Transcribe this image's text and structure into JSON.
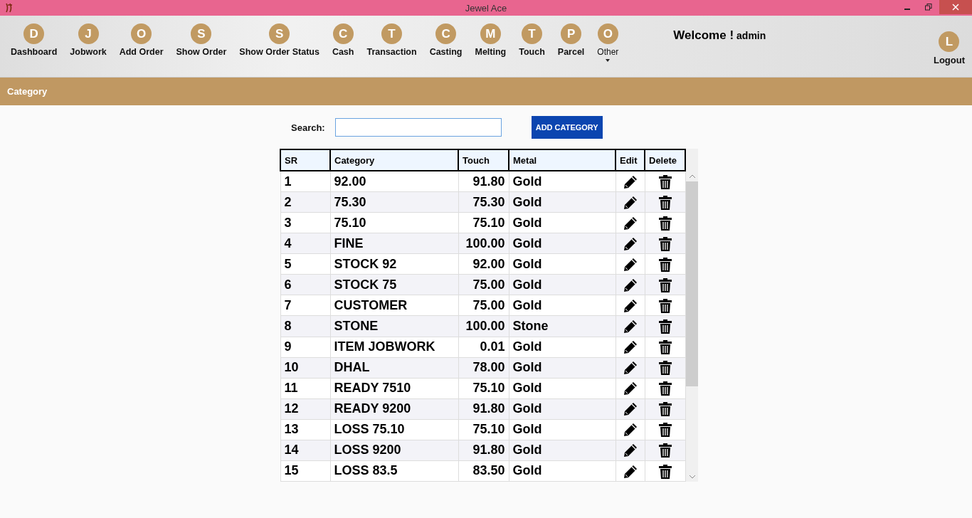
{
  "window": {
    "title": "Jewel Ace"
  },
  "nav": {
    "items": [
      {
        "letter": "D",
        "label": "Dashboard",
        "kind": "link"
      },
      {
        "letter": "J",
        "label": "Jobwork",
        "kind": "link"
      },
      {
        "letter": "O",
        "label": "Add Order",
        "kind": "link"
      },
      {
        "letter": "S",
        "label": "Show Order",
        "kind": "link"
      },
      {
        "letter": "S",
        "label": "Show Order Status",
        "kind": "link"
      },
      {
        "letter": "C",
        "label": "Cash",
        "kind": "link"
      },
      {
        "letter": "T",
        "label": "Transaction",
        "kind": "link"
      },
      {
        "letter": "C",
        "label": "Casting",
        "kind": "link"
      },
      {
        "letter": "M",
        "label": "Melting",
        "kind": "link"
      },
      {
        "letter": "T",
        "label": "Touch",
        "kind": "link"
      },
      {
        "letter": "P",
        "label": "Parcel",
        "kind": "link"
      },
      {
        "letter": "O",
        "label": "Other",
        "kind": "dropdown"
      }
    ],
    "welcome": "Welcome !",
    "user": "admin",
    "logout": {
      "letter": "L",
      "label": "Logout"
    }
  },
  "section_title": "Category",
  "search": {
    "label": "Search:"
  },
  "add_button": "ADD CATEGORY",
  "table": {
    "columns": [
      "SR",
      "Category",
      "Touch",
      "Metal",
      "Edit",
      "Delete"
    ],
    "rows": [
      {
        "sr": "1",
        "category": "92.00",
        "touch": "91.80",
        "metal": "Gold"
      },
      {
        "sr": "2",
        "category": "75.30",
        "touch": "75.30",
        "metal": "Gold"
      },
      {
        "sr": "3",
        "category": "75.10",
        "touch": "75.10",
        "metal": "Gold"
      },
      {
        "sr": "4",
        "category": "FINE",
        "touch": "100.00",
        "metal": "Gold"
      },
      {
        "sr": "5",
        "category": "STOCK 92",
        "touch": "92.00",
        "metal": "Gold"
      },
      {
        "sr": "6",
        "category": "STOCK 75",
        "touch": "75.00",
        "metal": "Gold"
      },
      {
        "sr": "7",
        "category": "CUSTOMER",
        "touch": "75.00",
        "metal": "Gold"
      },
      {
        "sr": "8",
        "category": "STONE",
        "touch": "100.00",
        "metal": "Stone"
      },
      {
        "sr": "9",
        "category": "ITEM JOBWORK",
        "touch": "0.01",
        "metal": "Gold"
      },
      {
        "sr": "10",
        "category": "DHAL",
        "touch": "78.00",
        "metal": "Gold"
      },
      {
        "sr": "11",
        "category": "READY 7510",
        "touch": "75.10",
        "metal": "Gold"
      },
      {
        "sr": "12",
        "category": "READY 9200",
        "touch": "91.80",
        "metal": "Gold"
      },
      {
        "sr": "13",
        "category": "LOSS 75.10",
        "touch": "75.10",
        "metal": "Gold"
      },
      {
        "sr": "14",
        "category": "LOSS 9200",
        "touch": "91.80",
        "metal": "Gold"
      },
      {
        "sr": "15",
        "category": "LOSS 83.5",
        "touch": "83.50",
        "metal": "Gold"
      }
    ]
  }
}
